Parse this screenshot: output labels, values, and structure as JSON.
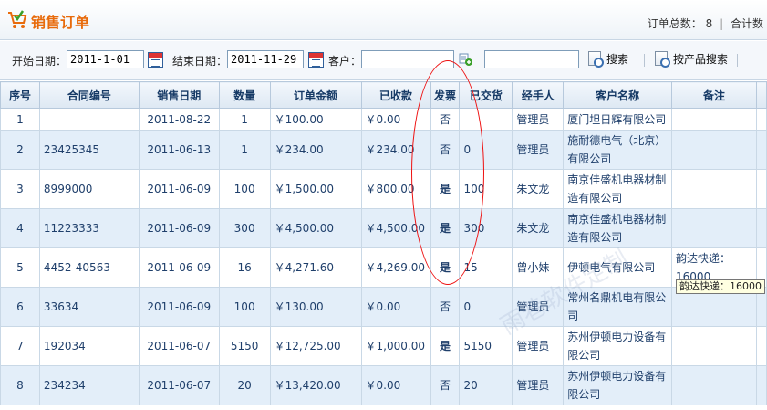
{
  "header": {
    "title": "销售订单",
    "summary_total_label": "订单总数：",
    "summary_total_value": "8",
    "summary_sep": "|",
    "summary_sum_label": "合计数"
  },
  "filters": {
    "start_label": "开始日期：",
    "start_value": "2011-1-01",
    "end_label": "结束日期：",
    "end_value": "2011-11-29",
    "customer_label": "客户：",
    "customer_value": "",
    "keyword_value": "",
    "search_label": "搜索",
    "product_search_label": "按产品搜索"
  },
  "table": {
    "columns": [
      "序号",
      "合同编号",
      "销售日期",
      "数量",
      "订单金额",
      "已收款",
      "发票",
      "已交货",
      "经手人",
      "客户名称",
      "备注"
    ],
    "rows": [
      {
        "no": "1",
        "contract": "",
        "date": "2011-08-22",
        "qty": "1",
        "amount": "￥100.00",
        "received": "￥0.00",
        "invoice": "否",
        "delivered": "",
        "handler": "管理员",
        "customer": "厦门坦日辉有限公司",
        "remark": ""
      },
      {
        "no": "2",
        "contract": "23425345",
        "date": "2011-06-13",
        "qty": "1",
        "amount": "￥234.00",
        "received": "￥234.00",
        "invoice": "否",
        "delivered": "0",
        "handler": "管理员",
        "customer": "施耐德电气（北京）有限公司",
        "remark": ""
      },
      {
        "no": "3",
        "contract": "8999000",
        "date": "2011-06-09",
        "qty": "100",
        "amount": "￥1,500.00",
        "received": "￥800.00",
        "invoice": "是",
        "delivered": "100",
        "handler": "朱文龙",
        "customer": "南京佳盛机电器材制造有限公司",
        "remark": ""
      },
      {
        "no": "4",
        "contract": "11223333",
        "date": "2011-06-09",
        "qty": "300",
        "amount": "￥4,500.00",
        "received": "￥4,500.00",
        "invoice": "是",
        "delivered": "300",
        "handler": "朱文龙",
        "customer": "南京佳盛机电器材制造有限公司",
        "remark": ""
      },
      {
        "no": "5",
        "contract": "4452-40563",
        "date": "2011-06-09",
        "qty": "16",
        "amount": "￥4,271.60",
        "received": "￥4,269.00",
        "invoice": "是",
        "delivered": "15",
        "handler": "曾小妹",
        "customer": "伊顿电气有限公司",
        "remark": "韵达快递：16000"
      },
      {
        "no": "6",
        "contract": "33634",
        "date": "2011-06-09",
        "qty": "100",
        "amount": "￥130.00",
        "received": "￥0.00",
        "invoice": "否",
        "delivered": "0",
        "handler": "管理员",
        "customer": "常州名鼎机电有限公司",
        "remark": ""
      },
      {
        "no": "7",
        "contract": "192034",
        "date": "2011-06-07",
        "qty": "5150",
        "amount": "￥12,725.00",
        "received": "￥1,000.00",
        "invoice": "是",
        "delivered": "5150",
        "handler": "管理员",
        "customer": "苏州伊顿电力设备有限公司",
        "remark": ""
      },
      {
        "no": "8",
        "contract": "234234",
        "date": "2011-06-07",
        "qty": "20",
        "amount": "￥13,420.00",
        "received": "￥0.00",
        "invoice": "否",
        "delivered": "20",
        "handler": "管理员",
        "customer": "苏州伊顿电力设备有限公司",
        "remark": ""
      }
    ],
    "tooltip": "韵达快递：16000",
    "watermark": "雨巷软件定制"
  },
  "colors": {
    "title": "#e86b0c",
    "money": "#d60000",
    "row_alt": "#e3eef9",
    "circle": "#ee1111"
  },
  "icons": [
    "cart-icon",
    "calendar-icon",
    "customer-picker-icon",
    "search-doc-icon"
  ]
}
